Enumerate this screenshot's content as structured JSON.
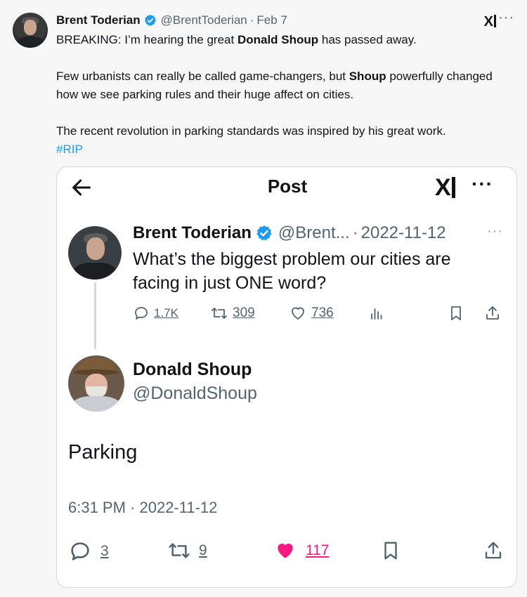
{
  "outer_tweet": {
    "name": "Brent Toderian",
    "handle": "@BrentToderian",
    "separator": "·",
    "date": "Feb 7",
    "brand_icon": "x-logo-icon",
    "menu_icon": "more-dots-icon",
    "text": {
      "line1_pre": "BREAKING: I’m hearing the great ",
      "line1_bold": "Donald Shoup",
      "line1_post": " has passed away.",
      "line2_pre": "Few urbanists can really be called game-changers, but ",
      "line2_bold": "Shoup",
      "line2_post": " powerfully changed how we see parking rules and their huge affect on cities.",
      "line3": "The recent revolution in parking standards was inspired by his great work.",
      "hashtag": "#RIP"
    },
    "verified_color": "#1d9bf0"
  },
  "card": {
    "title": "Post",
    "back_icon": "back-arrow-icon",
    "x_logo": "x-logo-icon",
    "menu": "more-dots-icon",
    "reply_to": {
      "name": "Brent Toderian",
      "handle": "@Brent...",
      "separator": "·",
      "date": "2022-11-12",
      "text": "What’s the biggest problem our cities are facing in just ONE word?",
      "actions": {
        "replies": "1.7K",
        "reposts": "309",
        "likes": "736"
      }
    },
    "post": {
      "name": "Donald Shoup",
      "handle": "@DonaldShoup",
      "text": "Parking",
      "timestamp": "6:31 PM · 2022-11-12",
      "actions": {
        "replies": "3",
        "reposts": "9",
        "likes": "117"
      },
      "like_color": "#f91880"
    }
  }
}
